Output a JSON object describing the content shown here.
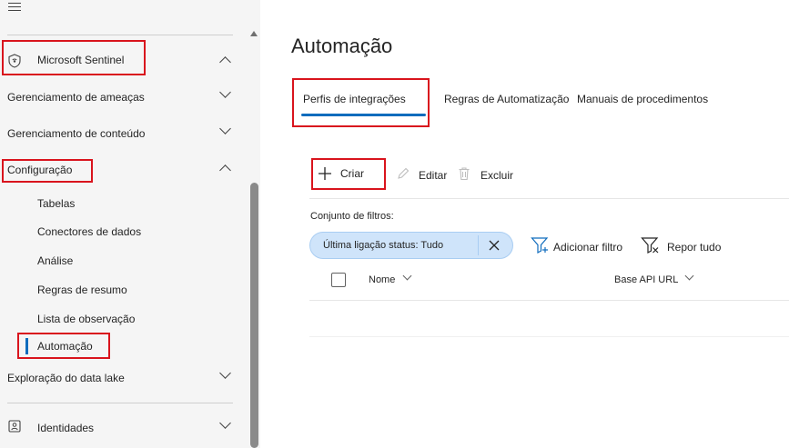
{
  "sidebar": {
    "sentinel_label": "Microsoft Sentinel",
    "threat_mgmt_label": "Gerenciamento de ameaças",
    "content_mgmt_label": "Gerenciamento de conteúdo",
    "configuration_label": "Configuração",
    "sub_items": {
      "tables": "Tabelas",
      "data_connectors": "Conectores de dados",
      "analytics": "Análise",
      "summary_rules": "Regras de resumo",
      "watchlist": "Lista de observação",
      "automation": "Automação"
    },
    "data_lake_label": "Exploração do data lake",
    "identities_label": "Identidades"
  },
  "main": {
    "title": "Automação",
    "tabs": {
      "integration_profiles": "Perfis de integrações",
      "automation_rules": "Regras de Automatização",
      "playbooks": "Manuais de procedimentos"
    },
    "toolbar": {
      "create_label": "Criar",
      "edit_label": "Editar",
      "delete_label": "Excluir"
    },
    "filters": {
      "label": "Conjunto de filtros:",
      "pill_text": "Última ligação status: Tudo",
      "add_filter_label": "Adicionar filtro",
      "reset_label": "Repor tudo"
    },
    "table": {
      "col_name": "Nome",
      "col_base_api_url": "Base API URL"
    }
  },
  "colors": {
    "accent": "#0f6cbd",
    "highlight_box": "#d9141d",
    "pill_bg": "#cfe4fa"
  }
}
